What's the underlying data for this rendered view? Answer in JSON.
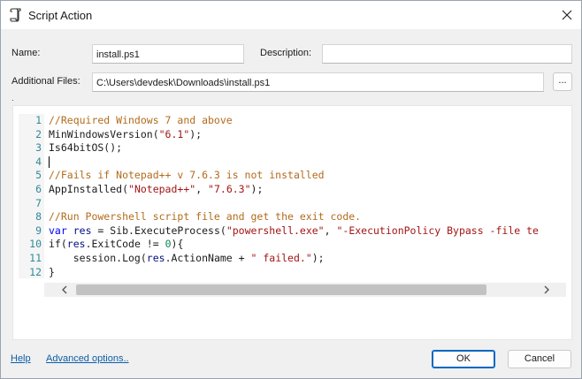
{
  "window": {
    "title": "Script Action",
    "icon": "script-icon"
  },
  "form": {
    "name_label": "Name:",
    "name_value": "install.ps1",
    "description_label": "Description:",
    "description_value": "",
    "files_label": "Additional Files:",
    "files_value": "C:\\Users\\devdesk\\Downloads\\install.ps1",
    "browse_label": "..."
  },
  "editor": {
    "line_numbers": [
      "1",
      "2",
      "3",
      "4",
      "5",
      "6",
      "7",
      "8",
      "9",
      "10",
      "11",
      "12"
    ],
    "lines": [
      "//Required Windows 7 and above",
      "MinWindowsVersion(\"6.1\");",
      "Is64bitOS();",
      "",
      "//Fails if Notepad++ v 7.6.3 is not installed",
      "AppInstalled(\"Notepad++\", \"7.6.3\");",
      "",
      "//Run Powershell script file and get the exit code.",
      "var res = Sib.ExecuteProcess(\"powershell.exe\", \"-ExecutionPolicy Bypass -file te",
      "if(res.ExitCode != 0){",
      "    session.Log(res.ActionName + \" failed.\");",
      "}"
    ],
    "colors": {
      "comment": "#b26b1c",
      "string": "#a31515",
      "number": "#098658",
      "keyword": "#0000ff",
      "variable": "#001080",
      "line_number": "#2e8a9a"
    }
  },
  "footer": {
    "help_label": "Help",
    "advanced_label": "Advanced options..",
    "ok_label": "OK",
    "cancel_label": "Cancel"
  }
}
